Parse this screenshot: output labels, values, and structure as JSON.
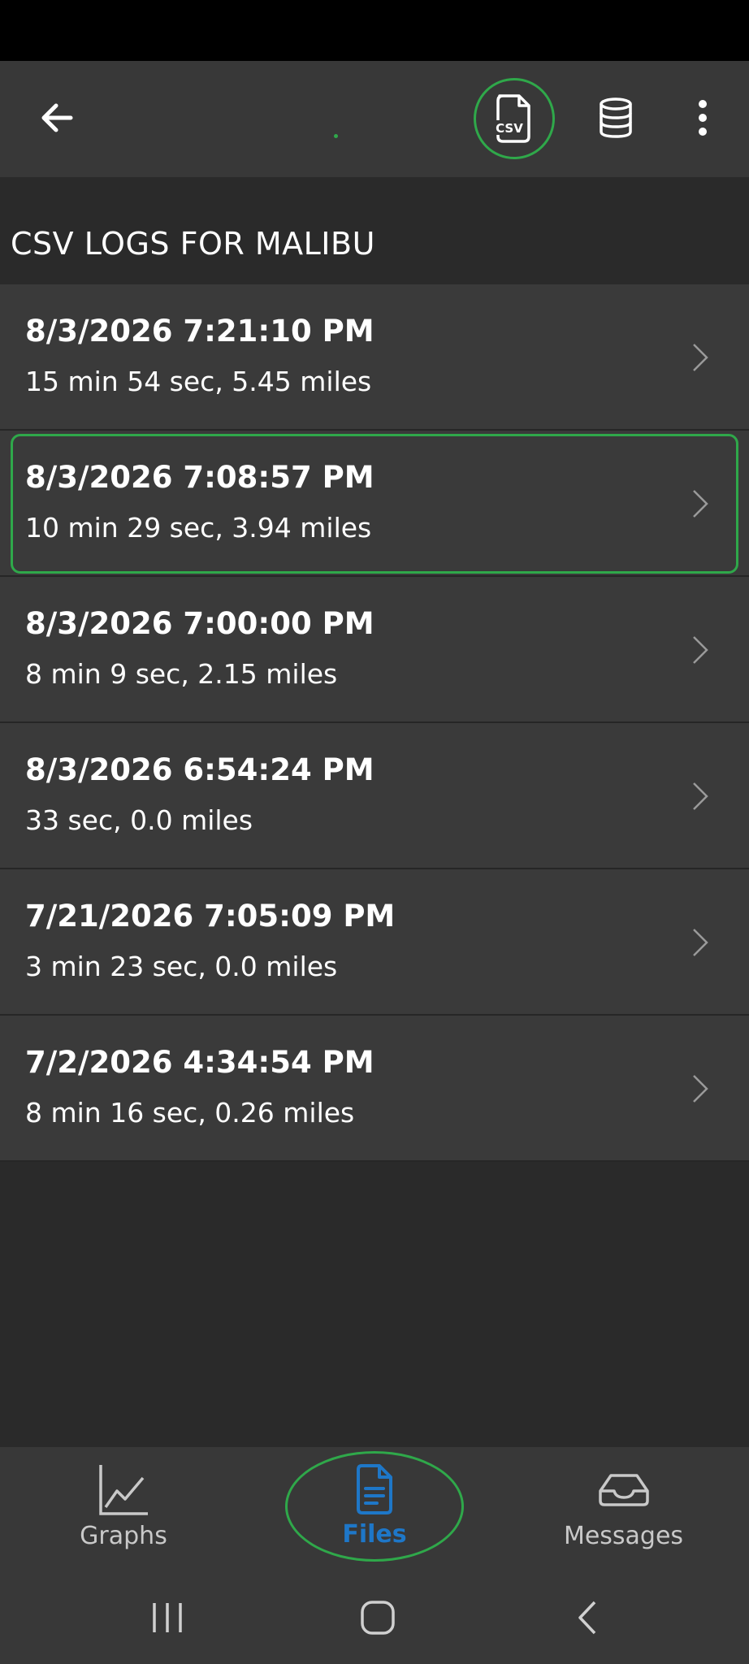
{
  "section": {
    "title": "CSV LOGS FOR MALIBU"
  },
  "toolbar": {
    "csv_icon_text": "CSV",
    "icons": [
      "back-arrow-icon",
      "csv-file-icon",
      "database-icon",
      "more-vertical-icon"
    ]
  },
  "logs": [
    {
      "title": "8/3/2026 7:21:10 PM",
      "subtitle": "15 min 54 sec, 5.45 miles"
    },
    {
      "title": "8/3/2026 7:08:57 PM",
      "subtitle": "10 min 29 sec, 3.94 miles"
    },
    {
      "title": "8/3/2026 7:00:00 PM",
      "subtitle": "8 min 9 sec, 2.15 miles"
    },
    {
      "title": "8/3/2026 6:54:24 PM",
      "subtitle": "33 sec, 0.0 miles"
    },
    {
      "title": "7/21/2026 7:05:09 PM",
      "subtitle": "3 min 23 sec, 0.0 miles"
    },
    {
      "title": "7/2/2026 4:34:54 PM",
      "subtitle": "8 min 16 sec, 0.26 miles"
    }
  ],
  "bottom_nav": {
    "graphs": "Graphs",
    "files": "Files",
    "messages": "Messages",
    "active": "Files"
  },
  "colors": {
    "highlight": "#2fa84a",
    "active_tab": "#1e77c8",
    "app_bar": "#383838",
    "background": "#2a2a2a",
    "list_item": "#3a3a3a"
  }
}
